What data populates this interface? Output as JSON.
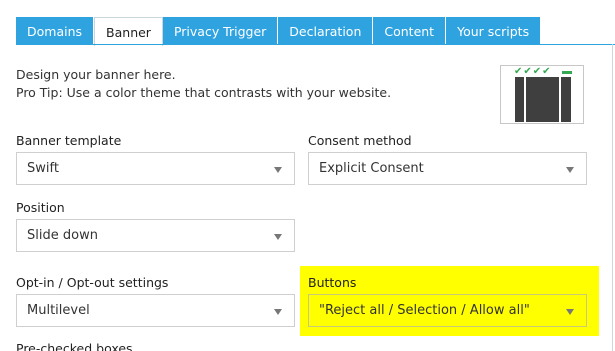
{
  "tabs": [
    {
      "label": "Domains",
      "active": false
    },
    {
      "label": "Banner",
      "active": true
    },
    {
      "label": "Privacy Trigger",
      "active": false
    },
    {
      "label": "Declaration",
      "active": false
    },
    {
      "label": "Content",
      "active": false
    },
    {
      "label": "Your scripts",
      "active": false
    }
  ],
  "intro": {
    "line1": "Design your banner here.",
    "line2": "Pro Tip: Use a color theme that contrasts with your website."
  },
  "thumbnail": {
    "checks": "✔✔✔✔",
    "icon": "banner-preview-thumbnail"
  },
  "fields": {
    "banner_template": {
      "label": "Banner template",
      "value": "Swift"
    },
    "consent_method": {
      "label": "Consent method",
      "value": "Explicit Consent"
    },
    "position": {
      "label": "Position",
      "value": "Slide down"
    },
    "opt_settings": {
      "label": "Opt-in / Opt-out settings",
      "value": "Multilevel"
    },
    "buttons": {
      "label": "Buttons",
      "value": "\"Reject all / Selection / Allow all\""
    },
    "prechecked": {
      "label": "Pre-checked boxes"
    }
  },
  "colors": {
    "tab_blue": "#2ea3e0",
    "highlight": "#ffff00"
  }
}
